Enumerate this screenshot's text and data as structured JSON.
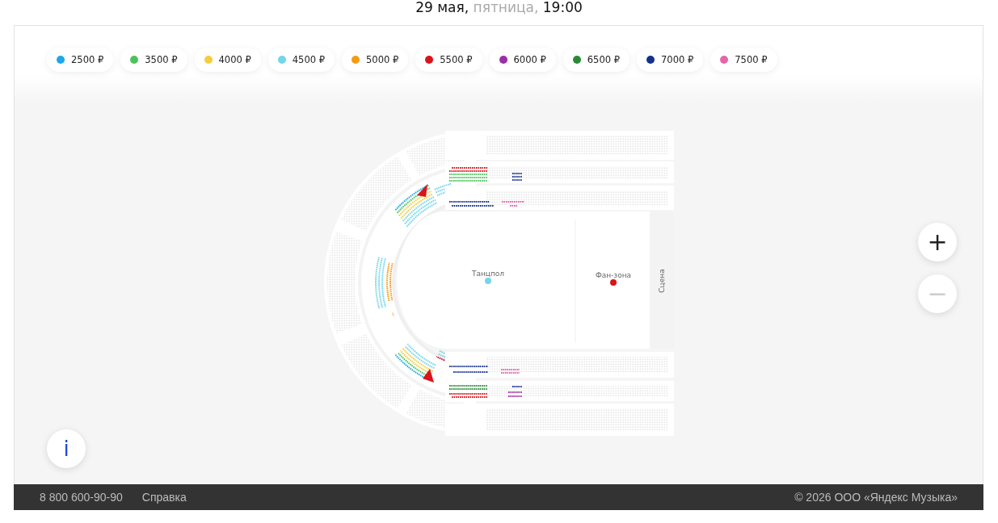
{
  "header": {
    "date": "29 мая,",
    "weekday": "пятница,",
    "time": "19:00"
  },
  "legend": [
    {
      "label": "2500 ₽",
      "color": "#1ea7e8"
    },
    {
      "label": "3500 ₽",
      "color": "#4cc35a"
    },
    {
      "label": "4000 ₽",
      "color": "#f5cd3f"
    },
    {
      "label": "4500 ₽",
      "color": "#72d6ec"
    },
    {
      "label": "5000 ₽",
      "color": "#f49b16"
    },
    {
      "label": "5500 ₽",
      "color": "#d8151a"
    },
    {
      "label": "6000 ₽",
      "color": "#9b2fa6"
    },
    {
      "label": "6500 ₽",
      "color": "#2b8a36"
    },
    {
      "label": "7000 ₽",
      "color": "#14308f"
    },
    {
      "label": "7500 ₽",
      "color": "#e466a9"
    }
  ],
  "map": {
    "zones": [
      {
        "label": "Танцпол",
        "color": "#72d6ec"
      },
      {
        "label": "Фан-зона",
        "color": "#d8151a"
      }
    ],
    "stage": "Сцена"
  },
  "zoom": [
    {
      "label": "+",
      "disabled": false
    },
    {
      "label": "−",
      "disabled": true
    }
  ],
  "info_button": "i",
  "footer": {
    "phone": "8 800 600-90-90",
    "help": "Справка",
    "copyright": "© 2026 ООО «Яндекс Музыка»"
  }
}
